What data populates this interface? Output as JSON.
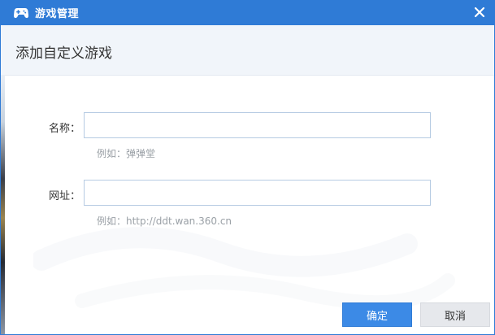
{
  "window": {
    "title": "游戏管理",
    "icons": {
      "title": "gamepad-icon",
      "close": "close-icon"
    }
  },
  "header": {
    "heading": "添加自定义游戏"
  },
  "form": {
    "name_label": "名称：",
    "name_value": "",
    "name_hint": "例如：弹弹堂",
    "url_label": "网址：",
    "url_value": "",
    "url_hint": "例如：http://ddt.wan.360.cn"
  },
  "buttons": {
    "ok": "确定",
    "cancel": "取消"
  },
  "colors": {
    "titlebar": "#2f7bd6",
    "primary_button": "#3c8ae6",
    "secondary_button": "#e6e8ec",
    "header_bg": "#f1f5fa",
    "input_border": "#b6cbe3",
    "hint_text": "#9aa0a6"
  }
}
